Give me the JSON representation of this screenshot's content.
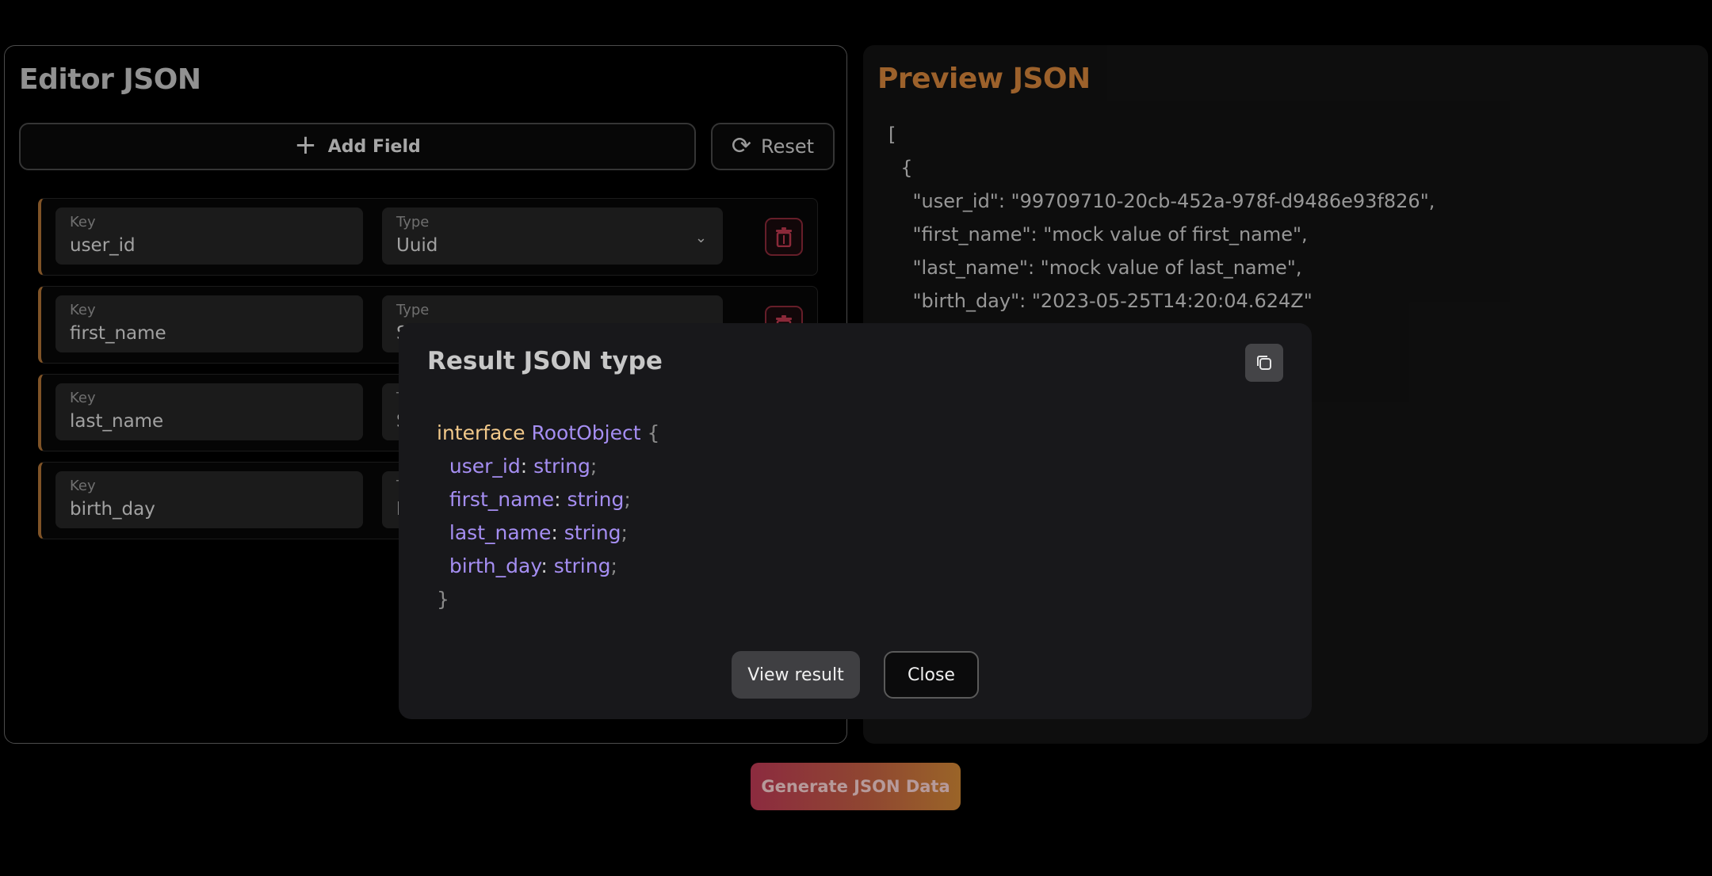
{
  "editor": {
    "title": "Editor JSON",
    "add_field_label": "Add Field",
    "reset_label": "Reset",
    "fields": [
      {
        "key_label": "Key",
        "key_value": "user_id",
        "type_label": "Type",
        "type_value": "Uuid"
      },
      {
        "key_label": "Key",
        "key_value": "first_name",
        "type_label": "Type",
        "type_value": "S"
      },
      {
        "key_label": "Key",
        "key_value": "last_name",
        "type_label": "T",
        "type_value": "S"
      },
      {
        "key_label": "Key",
        "key_value": "birth_day",
        "type_label": "T",
        "type_value": "D"
      }
    ]
  },
  "preview": {
    "title": "Preview JSON",
    "lines": [
      "[",
      "  {",
      "    \"user_id\": \"99709710-20cb-452a-978f-d9486e93f826\",",
      "    \"first_name\": \"mock value of first_name\",",
      "    \"last_name\": \"mock value of last_name\",",
      "    \"birth_day\": \"2023-05-25T14:20:04.624Z\"",
      "  }"
    ]
  },
  "generate_label": "Generate JSON Data",
  "modal": {
    "title": "Result JSON type",
    "keyword": "interface",
    "type_name": "RootObject",
    "open_brace": "{",
    "close_brace": "}",
    "props": [
      {
        "name": "user_id",
        "type": "string"
      },
      {
        "name": "first_name",
        "type": "string"
      },
      {
        "name": "last_name",
        "type": "string"
      },
      {
        "name": "birth_day",
        "type": "string"
      }
    ],
    "view_result_label": "View result",
    "close_label": "Close"
  },
  "colors": {
    "accent_orange": "#c47a36",
    "delete_red": "#8e2a3a",
    "code_purple": "#a58ef2",
    "code_keyword": "#f2c98a"
  }
}
